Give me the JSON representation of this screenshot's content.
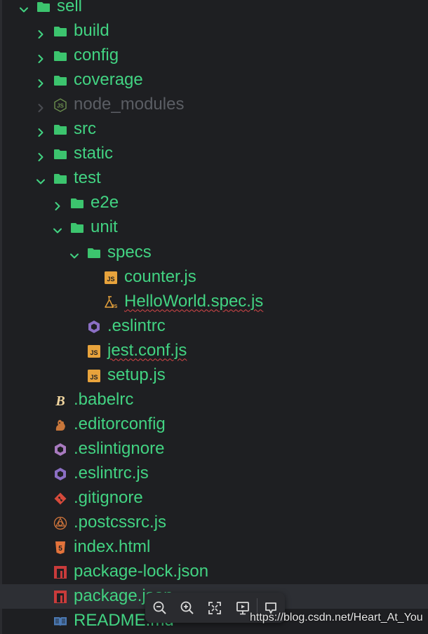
{
  "colors": {
    "background": "#1e1f22",
    "label": "#42d382",
    "label_muted": "#5b5e64",
    "folder": "#3cc46e",
    "js_badge": "#e8a33c",
    "squiggle": "#d94848"
  },
  "tree": [
    {
      "label": "sell",
      "kind": "folder",
      "icon": "folder-icon",
      "expanded": true
    },
    {
      "label": "build",
      "kind": "folder",
      "icon": "folder-icon",
      "expanded": false
    },
    {
      "label": "config",
      "kind": "folder",
      "icon": "folder-icon",
      "expanded": false
    },
    {
      "label": "coverage",
      "kind": "folder",
      "icon": "folder-icon",
      "expanded": false
    },
    {
      "label": "node_modules",
      "kind": "folder",
      "icon": "nodejs-icon",
      "expanded": false,
      "muted": true
    },
    {
      "label": "src",
      "kind": "folder",
      "icon": "folder-icon",
      "expanded": false
    },
    {
      "label": "static",
      "kind": "folder",
      "icon": "folder-icon",
      "expanded": false
    },
    {
      "label": "test",
      "kind": "folder",
      "icon": "folder-icon",
      "expanded": true
    },
    {
      "label": "e2e",
      "kind": "folder",
      "icon": "folder-icon",
      "expanded": false
    },
    {
      "label": "unit",
      "kind": "folder",
      "icon": "folder-icon",
      "expanded": true
    },
    {
      "label": "specs",
      "kind": "folder",
      "icon": "folder-icon",
      "expanded": true
    },
    {
      "label": "counter.js",
      "kind": "file",
      "icon": "js-file-icon"
    },
    {
      "label": "HelloWorld.spec.js",
      "kind": "file",
      "icon": "test-flask-icon",
      "error": true
    },
    {
      "label": ".eslintrc",
      "kind": "file",
      "icon": "eslint-icon"
    },
    {
      "label": "jest.conf.js",
      "kind": "file",
      "icon": "js-file-icon",
      "error": true
    },
    {
      "label": "setup.js",
      "kind": "file",
      "icon": "js-file-icon"
    },
    {
      "label": ".babelrc",
      "kind": "file",
      "icon": "babel-icon"
    },
    {
      "label": ".editorconfig",
      "kind": "file",
      "icon": "editorconfig-icon"
    },
    {
      "label": ".eslintignore",
      "kind": "file",
      "icon": "eslint-ignore-icon"
    },
    {
      "label": ".eslintrc.js",
      "kind": "file",
      "icon": "eslint-icon"
    },
    {
      "label": ".gitignore",
      "kind": "file",
      "icon": "git-icon"
    },
    {
      "label": ".postcssrc.js",
      "kind": "file",
      "icon": "postcss-icon"
    },
    {
      "label": "index.html",
      "kind": "file",
      "icon": "html5-icon"
    },
    {
      "label": "package-lock.json",
      "kind": "file",
      "icon": "npm-icon"
    },
    {
      "label": "package.json",
      "kind": "file",
      "icon": "npm-icon",
      "highlighted": true
    },
    {
      "label": "README.md",
      "kind": "file",
      "icon": "readme-book-icon"
    }
  ],
  "toolbar": {
    "buttons": [
      {
        "name": "zoom-out-icon"
      },
      {
        "name": "zoom-in-icon"
      },
      {
        "name": "fit-screen-icon"
      },
      {
        "name": "slideshow-icon"
      },
      {
        "name": "comment-icon"
      }
    ]
  },
  "watermark": "https://blog.csdn.net/Heart_At_You"
}
